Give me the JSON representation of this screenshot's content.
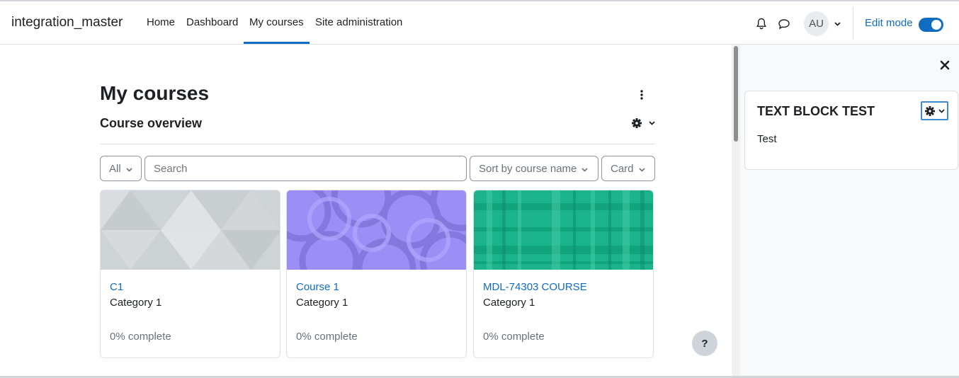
{
  "navbar": {
    "site_name": "integration_master",
    "links": [
      "Home",
      "Dashboard",
      "My courses",
      "Site administration"
    ],
    "active_link": "My courses",
    "user_initials": "AU",
    "edit_mode_label": "Edit mode",
    "edit_mode_on": true
  },
  "main": {
    "page_title": "My courses",
    "section_title": "Course overview",
    "filter": {
      "grouping_label": "All",
      "search_placeholder": "Search",
      "sort_label": "Sort by course name",
      "view_label": "Card"
    },
    "courses": [
      {
        "name": "C1",
        "category": "Category 1",
        "progress_text": "0% complete",
        "image_style": "triangles-gray"
      },
      {
        "name": "Course 1",
        "category": "Category 1",
        "progress_text": "0% complete",
        "image_style": "circles-purple"
      },
      {
        "name": "MDL-74303 COURSE",
        "category": "Category 1",
        "progress_text": "0% complete",
        "image_style": "plaid-green"
      }
    ],
    "help_label": "?"
  },
  "drawer": {
    "block_title": "TEXT BLOCK TEST",
    "block_content": "Test"
  },
  "colors": {
    "primary": "#0f6cbf",
    "text": "#1d2125",
    "muted": "#6a737b",
    "border": "#dee2e6"
  }
}
